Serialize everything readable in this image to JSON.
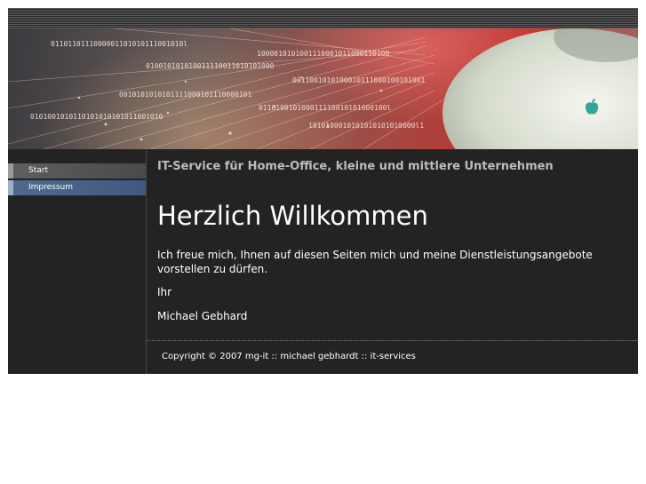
{
  "header": {
    "binary_lines": [
      "0110110111000001101010111001010l",
      "1000010101001110001011000110100",
      "010010101010011110011010101000",
      "0011001010100010111000100101001",
      "0010101010101111000101110000101",
      "011010010100011110010101000100l",
      "0101001010110101010101011001010",
      "1010100010101010101010000l1"
    ],
    "logo_icon": "apple-logo-icon"
  },
  "nav": {
    "items": [
      {
        "label": "Start"
      },
      {
        "label": "Impressum"
      }
    ]
  },
  "main": {
    "subtitle": "IT-Service für Home-Office, kleine und mittlere Unternehmen",
    "heading": "Herzlich Willkommen",
    "intro": "Ich freue mich, Ihnen auf diesen Seiten mich und meine Dienstleistungsangebote vorstellen zu dürfen.",
    "closing": "Ihr",
    "signature": "Michael Gebhard"
  },
  "footer": {
    "copyright": "Copyright © 2007 mg-it :: michael gebhardt :: it-services"
  },
  "colors": {
    "page_bg": "#ffffff",
    "site_bg": "#232323",
    "nav_active": "#4a4a4a",
    "nav_link": "#3e5a80",
    "text": "#ffffff",
    "subtitle": "#bcbcbc"
  }
}
